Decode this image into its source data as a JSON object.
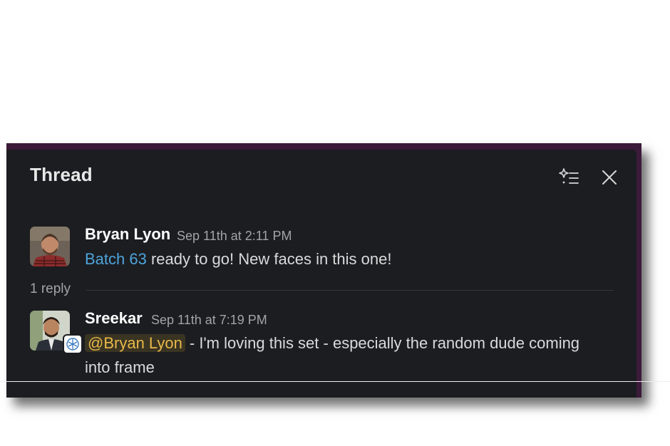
{
  "thread": {
    "title": "Thread"
  },
  "icons": {
    "ai_summary": "sparkle-list-icon",
    "close": "close-icon"
  },
  "parent_message": {
    "author": "Bryan Lyon",
    "timestamp": "Sep 11th at 2:11 PM",
    "link_text": "Batch 63",
    "text": " ready to go! New faces in this one!"
  },
  "reply_count": "1 reply",
  "reply_message": {
    "author": "Sreekar",
    "timestamp": "Sep 11th at 7:19 PM",
    "mention": "@Bryan Lyon",
    "text_line1": " - I'm loving this set - especially the random dude coming",
    "text_line2": "into frame"
  },
  "colors": {
    "panel_bg": "#1b1d21",
    "frame_bg": "#3b1a3a",
    "link": "#4ea4db",
    "mention_text": "#e8b84a",
    "mention_bg": "#3a3422"
  }
}
